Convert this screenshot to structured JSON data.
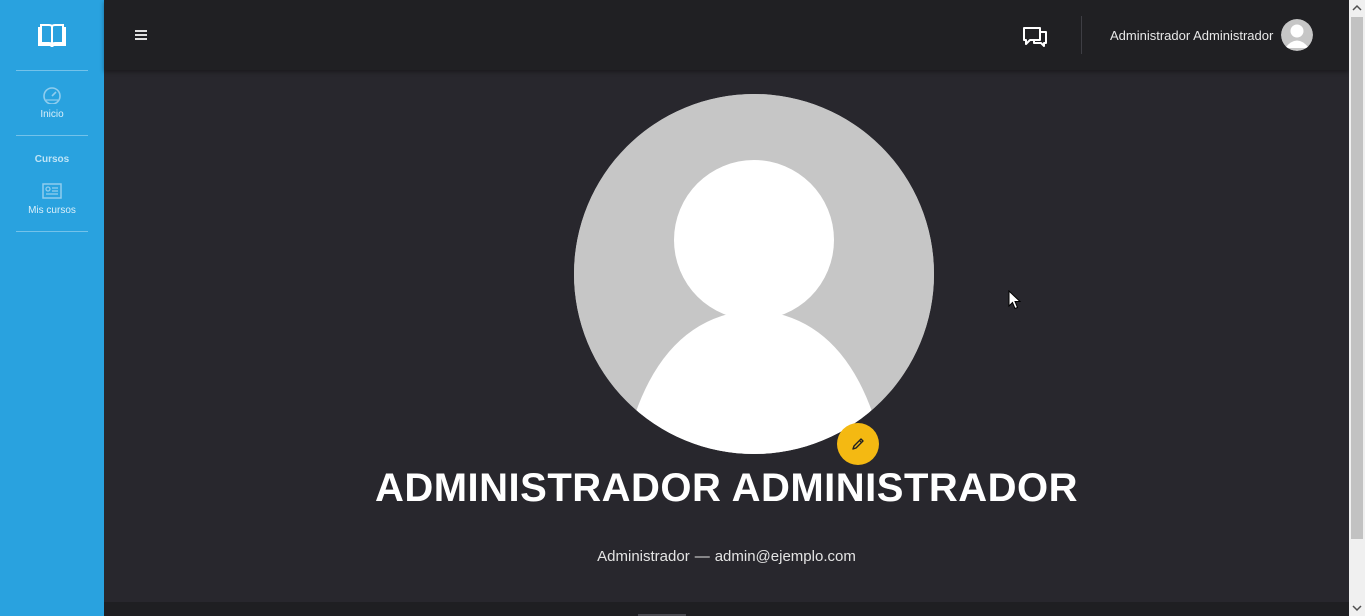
{
  "sidebar": {
    "items": [
      {
        "label": "Inicio",
        "icon": "dashboard-gauge-icon"
      },
      {
        "label": "Mis cursos",
        "icon": "courses-list-icon"
      }
    ],
    "section_title": "Cursos",
    "logo_icon": "open-book-icon"
  },
  "header": {
    "menu_icon": "hamburger-menu-icon",
    "chat_icon": "chat-bubbles-icon",
    "user_name": "Administrador Administrador",
    "user_avatar_icon": "user-avatar-icon"
  },
  "profile": {
    "name": "ADMINISTRADOR ADMINISTRADOR",
    "role": "Administrador",
    "separator": "—",
    "email": "admin@ejemplo.com",
    "edit_icon": "pencil-icon"
  },
  "colors": {
    "sidebar": "#29a2df",
    "topbar": "#202023",
    "background": "#28272d",
    "edit_button": "#f4b912",
    "avatar_bg": "#c6c6c6"
  }
}
